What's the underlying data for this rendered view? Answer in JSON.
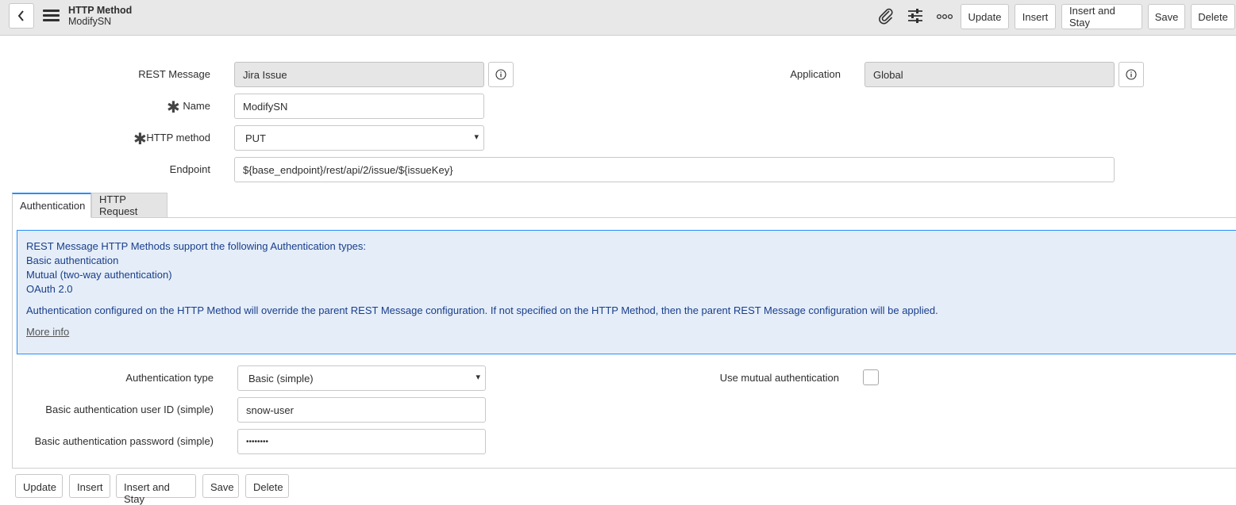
{
  "header": {
    "title": "HTTP Method",
    "subtitle": "ModifySN",
    "icons": [
      "paperclip-icon",
      "sliders-icon",
      "more-icon"
    ],
    "buttons": {
      "update": "Update",
      "insert": "Insert",
      "insert_and_stay": "Insert and Stay",
      "save": "Save",
      "delete": "Delete"
    }
  },
  "form": {
    "rest_message": {
      "label": "REST Message",
      "value": "Jira Issue"
    },
    "application": {
      "label": "Application",
      "value": "Global"
    },
    "name": {
      "label": "Name",
      "value": "ModifySN",
      "mandatory": "✱"
    },
    "http_method": {
      "label": "HTTP method",
      "value": "PUT",
      "mandatory": "✱"
    },
    "endpoint": {
      "label": "Endpoint",
      "value": "${base_endpoint}/rest/api/2/issue/${issueKey}"
    }
  },
  "tabs": [
    {
      "label": "Authentication",
      "active": true
    },
    {
      "label": "HTTP Request",
      "active": false
    }
  ],
  "info": {
    "lines": [
      "REST Message HTTP Methods support the following Authentication types:",
      "Basic authentication",
      "Mutual (two-way authentication)",
      "OAuth 2.0"
    ],
    "override_note": "Authentication configured on the HTTP Method will override the parent REST Message configuration. If not specified on the HTTP Method, then the parent REST Message configuration will be applied.",
    "more_info": "More info"
  },
  "auth": {
    "type": {
      "label": "Authentication type",
      "value": "Basic (simple)"
    },
    "mutual": {
      "label": "Use mutual authentication",
      "checked": false
    },
    "user_id": {
      "label": "Basic authentication user ID (simple)",
      "value": "snow-user"
    },
    "password": {
      "label": "Basic authentication password (simple)",
      "value": "••••••••"
    }
  },
  "bottom_buttons": {
    "update": "Update",
    "insert": "Insert",
    "insert_and_stay": "Insert and Stay",
    "save": "Save",
    "delete": "Delete"
  },
  "colors": {
    "header_bg": "#e8e8e8",
    "info_bg": "#e5eef8",
    "info_border": "#278efc",
    "info_text": "#1a3e8c",
    "readonly_bg": "#e6e6e6"
  }
}
